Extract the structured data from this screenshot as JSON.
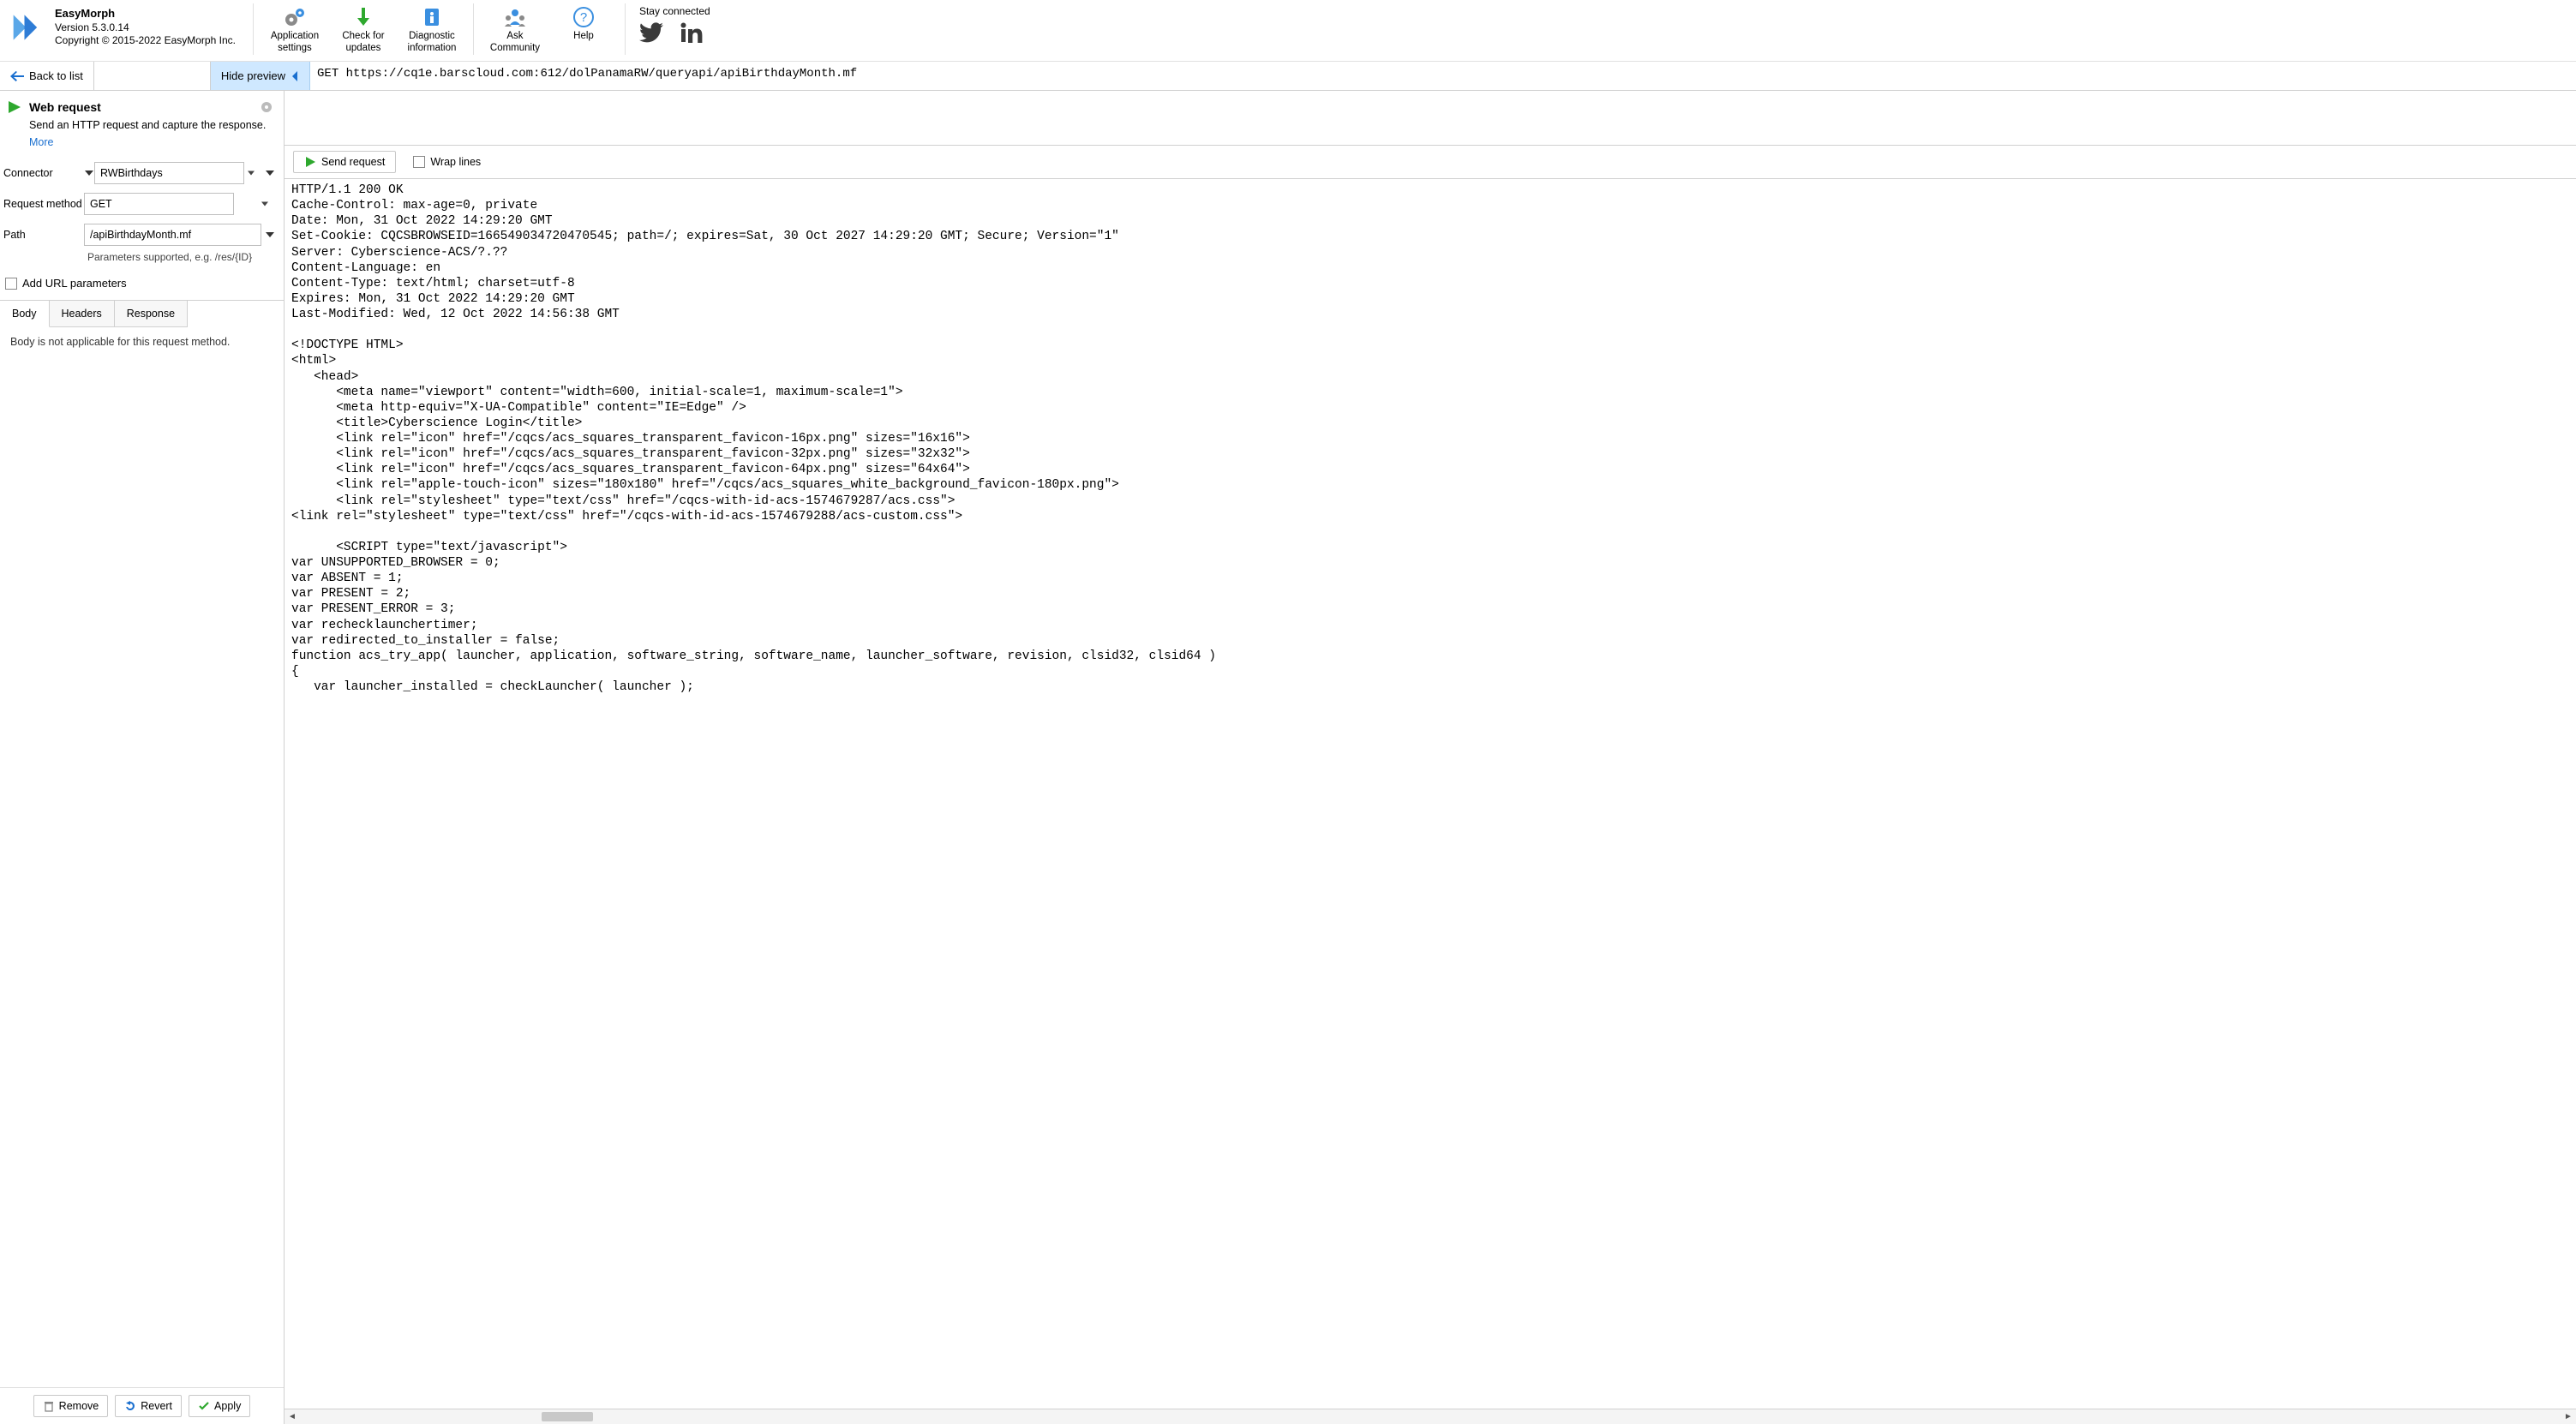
{
  "app": {
    "title": "EasyMorph",
    "version": "Version 5.3.0.14",
    "copyright": "Copyright © 2015-2022 EasyMorph Inc."
  },
  "ribbon": {
    "app_settings_l1": "Application",
    "app_settings_l2": "settings",
    "check_updates_l1": "Check for",
    "check_updates_l2": "updates",
    "diag_l1": "Diagnostic",
    "diag_l2": "information",
    "community_l1": "Ask",
    "community_l2": "Community",
    "help": "Help",
    "stay": "Stay connected"
  },
  "nav": {
    "back": "Back to list",
    "hide_preview": "Hide preview"
  },
  "request_summary": "GET https://cq1e.barscloud.com:612/dolPanamaRW/queryapi/apiBirthdayMonth.mf",
  "action": {
    "title": "Web request",
    "desc": "Send an HTTP request and capture the response.",
    "more": "More"
  },
  "form": {
    "connector_label": "Connector",
    "connector_value": "RWBirthdays",
    "method_label": "Request method",
    "method_value": "GET",
    "path_label": "Path",
    "path_value": "/apiBirthdayMonth.mf",
    "path_hint": "Parameters supported, e.g. /res/{ID}",
    "add_params": "Add URL parameters"
  },
  "tabs": {
    "body": "Body",
    "headers": "Headers",
    "response": "Response",
    "body_msg": "Body is not applicable for this request method."
  },
  "footer": {
    "remove": "Remove",
    "revert": "Revert",
    "apply": "Apply"
  },
  "right": {
    "send": "Send request",
    "wrap": "Wrap lines"
  },
  "response_text": "HTTP/1.1 200 OK\nCache-Control: max-age=0, private\nDate: Mon, 31 Oct 2022 14:29:20 GMT\nSet-Cookie: CQCSBROWSEID=166549034720470545; path=/; expires=Sat, 30 Oct 2027 14:29:20 GMT; Secure; Version=\"1\"\nServer: Cyberscience-ACS/?.??\nContent-Language: en\nContent-Type: text/html; charset=utf-8\nExpires: Mon, 31 Oct 2022 14:29:20 GMT\nLast-Modified: Wed, 12 Oct 2022 14:56:38 GMT\n\n<!DOCTYPE HTML>\n<html>\n   <head>\n      <meta name=\"viewport\" content=\"width=600, initial-scale=1, maximum-scale=1\">\n      <meta http-equiv=\"X-UA-Compatible\" content=\"IE=Edge\" />\n      <title>Cyberscience Login</title>\n      <link rel=\"icon\" href=\"/cqcs/acs_squares_transparent_favicon-16px.png\" sizes=\"16x16\">\n      <link rel=\"icon\" href=\"/cqcs/acs_squares_transparent_favicon-32px.png\" sizes=\"32x32\">\n      <link rel=\"icon\" href=\"/cqcs/acs_squares_transparent_favicon-64px.png\" sizes=\"64x64\">\n      <link rel=\"apple-touch-icon\" sizes=\"180x180\" href=\"/cqcs/acs_squares_white_background_favicon-180px.png\">\n      <link rel=\"stylesheet\" type=\"text/css\" href=\"/cqcs-with-id-acs-1574679287/acs.css\">\n<link rel=\"stylesheet\" type=\"text/css\" href=\"/cqcs-with-id-acs-1574679288/acs-custom.css\">\n\n      <SCRIPT type=\"text/javascript\">\nvar UNSUPPORTED_BROWSER = 0;\nvar ABSENT = 1;\nvar PRESENT = 2;\nvar PRESENT_ERROR = 3;\nvar rechecklaunchertimer;\nvar redirected_to_installer = false;\nfunction acs_try_app( launcher, application, software_string, software_name, launcher_software, revision, clsid32, clsid64 )\n{\n   var launcher_installed = checkLauncher( launcher );"
}
